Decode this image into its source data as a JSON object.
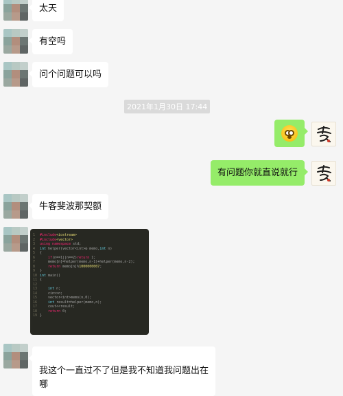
{
  "messages": [
    {
      "side": "left",
      "text": "太天"
    },
    {
      "side": "left",
      "text": "有空吗"
    },
    {
      "side": "left",
      "text": "问个问题可以吗"
    },
    {
      "side": "right",
      "emoji": "flushed-face-emoji"
    },
    {
      "side": "right",
      "text": "有问题你就直说就行"
    },
    {
      "side": "left",
      "text": "牛客斐波那契额"
    },
    {
      "side": "left",
      "image": "code-screenshot"
    },
    {
      "side": "left",
      "text": "我这个一直过不了但是我不知道我问题出在\n哪"
    }
  ],
  "timestamp": "2021年1月30日 17:44",
  "colors": {
    "background": "#f5f5f5",
    "bubble_left": "#ffffff",
    "bubble_right": "#95ec69"
  }
}
